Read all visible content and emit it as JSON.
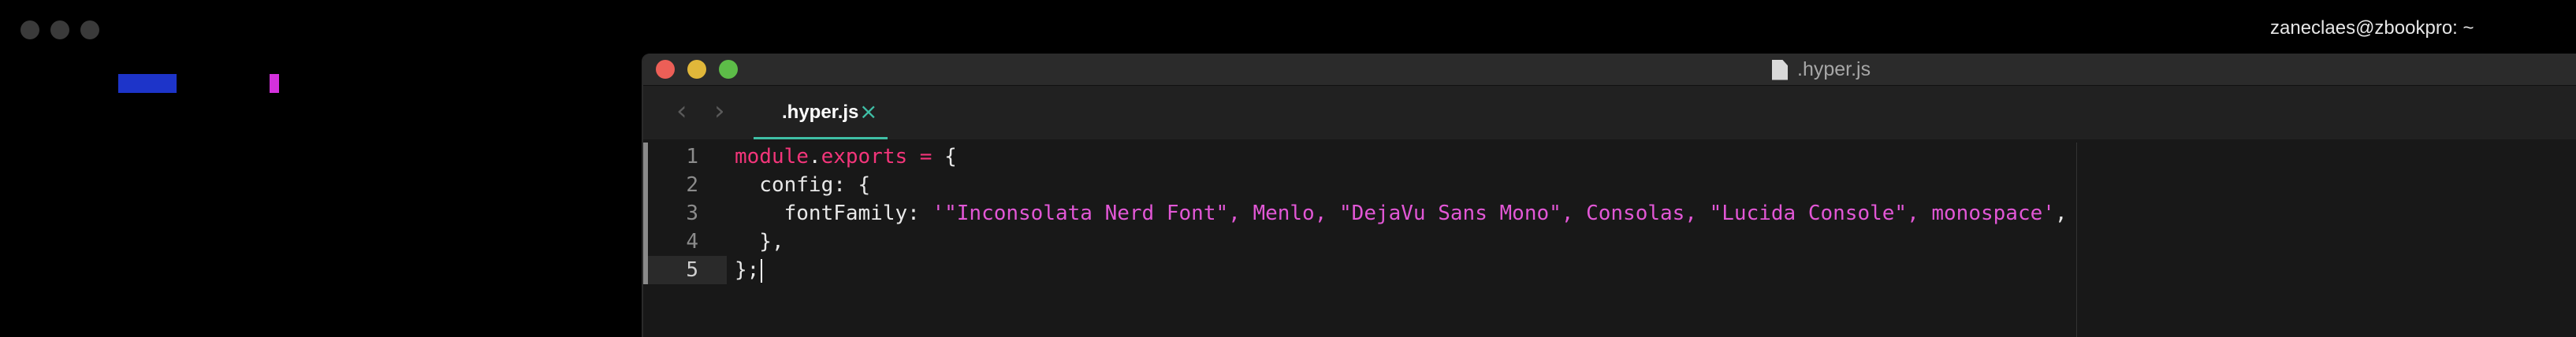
{
  "terminal": {
    "title": "zaneclaes@zbookpro: ~"
  },
  "editor": {
    "window_title": ".hyper.js",
    "tab": {
      "label": ".hyper.js",
      "close": "×"
    },
    "nav": {
      "back": "‹",
      "forward": "›"
    },
    "line_numbers": [
      "1",
      "2",
      "3",
      "4",
      "5"
    ],
    "code": {
      "l1_part1": "module",
      "l1_part2": ".",
      "l1_part3": "exports",
      "l1_part4": " = ",
      "l1_part5": "{",
      "l2": "  config: {",
      "l3_key": "    fontFamily: ",
      "l3_value": "'\"Inconsolata Nerd Font\", Menlo, \"DejaVu Sans Mono\", Consolas, \"Lucida Console\", monospace'",
      "l3_end": ",",
      "l4": "  },",
      "l5": "};"
    }
  },
  "colors": {
    "keyword": "#f3357a",
    "string": "#e257d6",
    "accent": "#3fbfa6",
    "close_button": "#ec5f57",
    "minimize_button": "#e0b73a",
    "maximize_button": "#5dbc48"
  }
}
